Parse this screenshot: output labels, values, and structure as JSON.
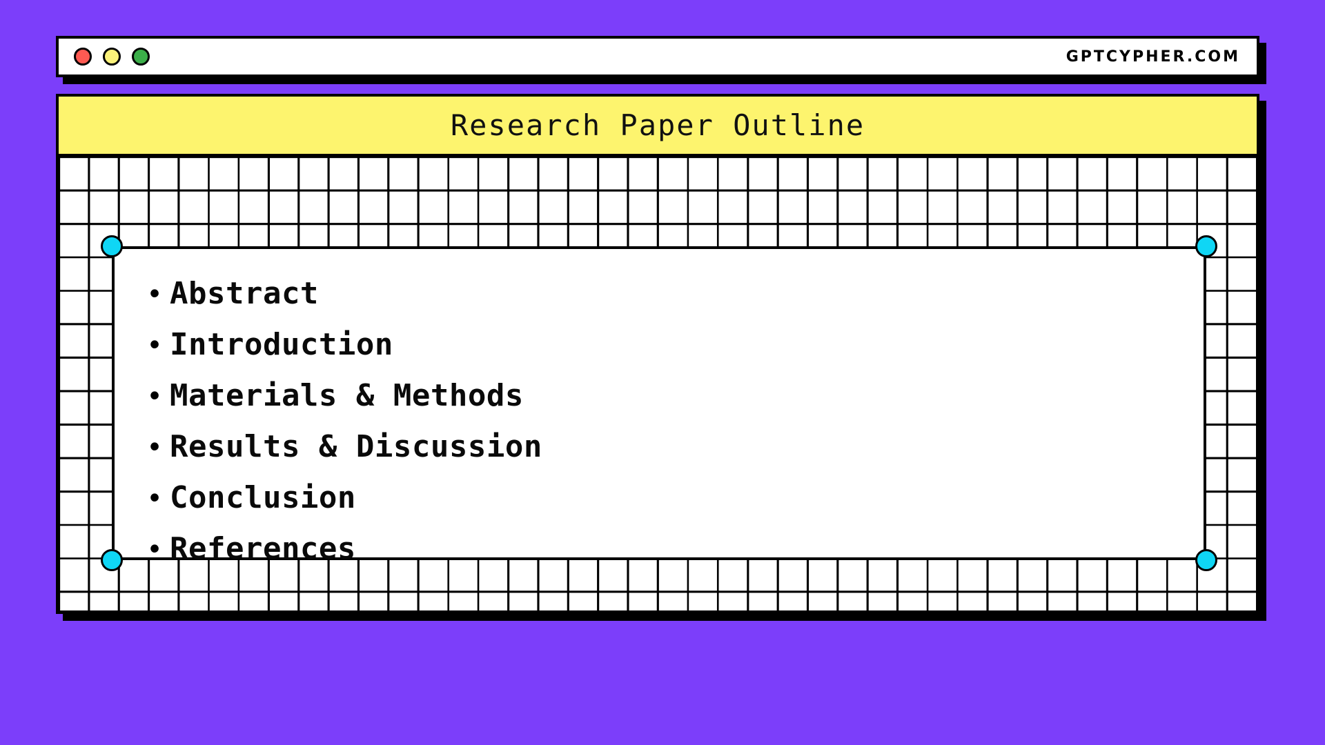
{
  "theme": {
    "background": "#7c3efa",
    "title_bar": "#fdf46e",
    "handle": "#0fd6f5",
    "ink": "#000000",
    "paper": "#ffffff"
  },
  "chrome": {
    "lights": [
      {
        "name": "close",
        "color": "#ff5a52"
      },
      {
        "name": "minimize",
        "color": "#fbf27a"
      },
      {
        "name": "maximize",
        "color": "#3bae49"
      }
    ],
    "site_url": "GPTCYPHER.COM"
  },
  "window": {
    "title": "Research Paper Outline"
  },
  "outline": {
    "bullet_glyph": "•",
    "items": [
      {
        "label": "Abstract"
      },
      {
        "label": "Introduction"
      },
      {
        "label": "Materials & Methods"
      },
      {
        "label": "Results & Discussion"
      },
      {
        "label": "Conclusion"
      },
      {
        "label": "References"
      }
    ]
  },
  "handles": [
    {
      "position": "top-left"
    },
    {
      "position": "top-right"
    },
    {
      "position": "bottom-left"
    },
    {
      "position": "bottom-right"
    }
  ]
}
